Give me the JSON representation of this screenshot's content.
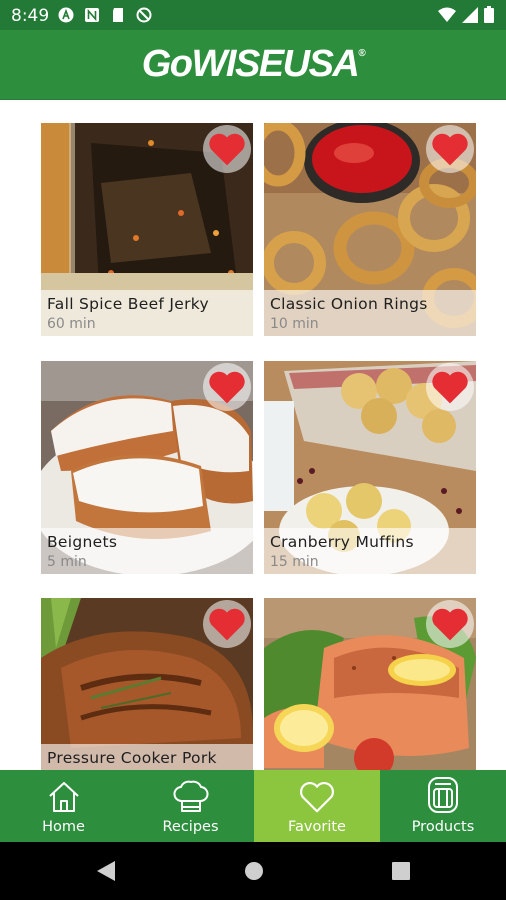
{
  "status_bar": {
    "time": "8:49"
  },
  "header": {
    "logo_text": "GoWISEUSA",
    "logo_mark": "®"
  },
  "recipes": [
    {
      "title": "Fall Spice Beef Jerky",
      "time": "60 min",
      "favorite": true
    },
    {
      "title": "Classic Onion Rings",
      "time": "10 min",
      "favorite": true
    },
    {
      "title": "Beignets",
      "time": "5 min",
      "favorite": true
    },
    {
      "title": "Cranberry Muffins",
      "time": "15 min",
      "favorite": true
    },
    {
      "title": "Pressure Cooker Pork",
      "time": "",
      "favorite": true
    },
    {
      "title": "",
      "time": "",
      "favorite": true
    }
  ],
  "bottom_nav": {
    "items": [
      {
        "label": "Home",
        "icon": "home-icon"
      },
      {
        "label": "Recipes",
        "icon": "chef-hat-icon"
      },
      {
        "label": "Favorite",
        "icon": "heart-icon",
        "active": true
      },
      {
        "label": "Products",
        "icon": "air-fryer-icon"
      }
    ]
  },
  "colors": {
    "brand_green": "#2d8f3e",
    "active_green": "#8cc63f",
    "heart_red": "#e52d34"
  }
}
